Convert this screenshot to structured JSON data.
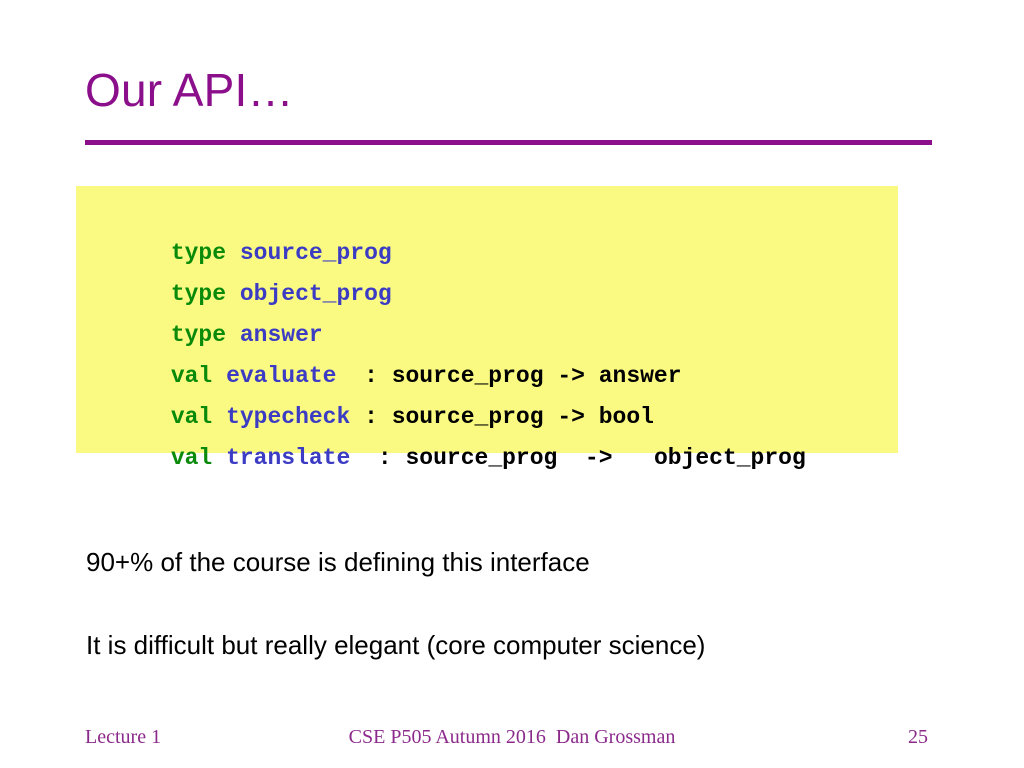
{
  "slide": {
    "title": "Our API…",
    "accent_color": "#8B0F8B",
    "code_block": {
      "background_color": "#FAFA82",
      "keyword_color": "#0A8A0A",
      "identifier_color": "#3B3BC4",
      "signature_color": "#000000",
      "lines": [
        {
          "keyword": "type",
          "gap1": " ",
          "identifier": "source_prog",
          "rest": ""
        },
        {
          "keyword": "type",
          "gap1": " ",
          "identifier": "object_prog",
          "rest": ""
        },
        {
          "keyword": "type",
          "gap1": " ",
          "identifier": "answer",
          "rest": ""
        },
        {
          "keyword": "val",
          "gap1": " ",
          "identifier": "evaluate",
          "rest": "  : source_prog -> answer"
        },
        {
          "keyword": "val",
          "gap1": " ",
          "identifier": "typecheck",
          "rest": " : source_prog -> bool"
        },
        {
          "keyword": "val",
          "gap1": " ",
          "identifier": "translate",
          "rest": "  : source_prog  ->   object_prog"
        }
      ]
    },
    "body": [
      "90+% of the course is defining this interface",
      "It is difficult but really elegant (core computer science)"
    ],
    "footer": {
      "left": "Lecture 1",
      "center": "CSE P505 Autumn 2016  Dan Grossman",
      "right": "25",
      "color": "#8B2A8B"
    }
  }
}
